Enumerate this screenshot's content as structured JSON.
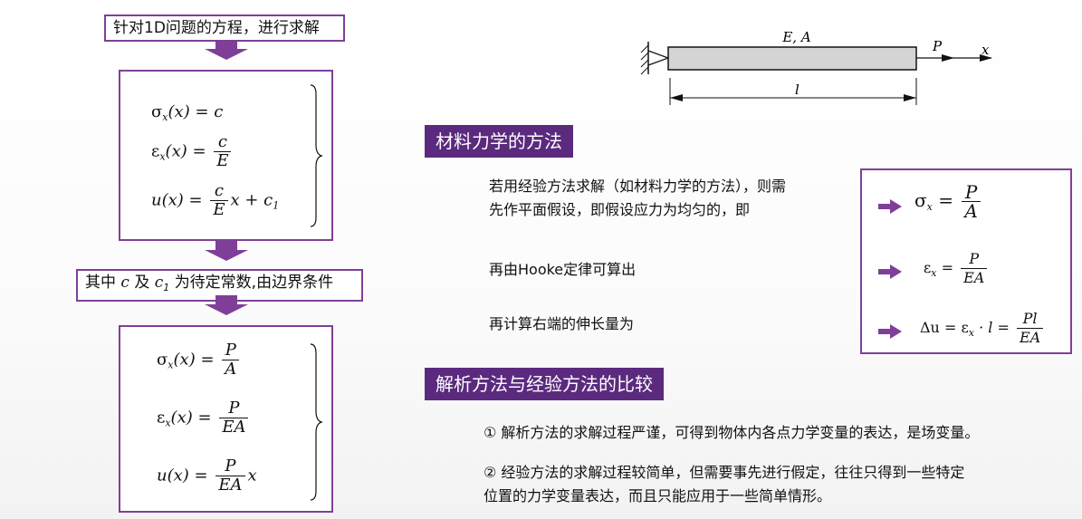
{
  "left": {
    "top_label": "针对1D问题的方程，进行求解",
    "eq1": {
      "lhs": "σ",
      "sub": "x",
      "arg": "(x)",
      "eq": "=",
      "rhs": "c"
    },
    "eq2": {
      "lhs": "ε",
      "sub": "x",
      "arg": "(x)",
      "eq": "=",
      "num": "c",
      "den": "E"
    },
    "eq3": {
      "lhs": "u(x)",
      "eq": "=",
      "num": "c",
      "den": "E",
      "tail": "x + c",
      "tail_sub": "1"
    },
    "mid_label_a": "其中",
    "mid_label_c": "c",
    "mid_label_and": "及",
    "mid_label_c1": "c",
    "mid_label_c1_sub": "1",
    "mid_label_b": "为待定常数,由边界条件",
    "eq4": {
      "lhs": "σ",
      "sub": "x",
      "arg": "(x)",
      "eq": "=",
      "num": "P",
      "den": "A"
    },
    "eq5": {
      "lhs": "ε",
      "sub": "x",
      "arg": "(x)",
      "eq": "=",
      "num": "P",
      "den": "EA"
    },
    "eq6": {
      "lhs": "u(x)",
      "eq": "=",
      "num": "P",
      "den": "EA",
      "tail": "x"
    }
  },
  "diagram": {
    "top_label": "E, A",
    "force_label": "P",
    "axis_label": "x",
    "length_label": "l"
  },
  "section1": {
    "title": "材料力学的方法",
    "para1_line1": "若用经验方法求解（如材料力学的方法），则需",
    "para1_line2": "先作平面假设，即假设应力为均匀的，即",
    "para2": "再由Hooke定律可算出",
    "para3": "再计算右端的伸长量为"
  },
  "right_box": {
    "eqA": {
      "lhs": "σ",
      "sub": "x",
      "eq": "=",
      "num": "P",
      "den": "A"
    },
    "eqB": {
      "lhs": "ε",
      "sub": "x",
      "eq": "=",
      "num": "P",
      "den": "EA"
    },
    "eqC": {
      "lhs": "Δu",
      "eq1": "=",
      "mid": "ε",
      "mid_sub": "x",
      "dot": "· l",
      "eq2": "=",
      "num": "Pl",
      "den": "EA"
    }
  },
  "section2": {
    "title": "解析方法与经验方法的比较",
    "item1": "①  解析方法的求解过程严谨，可得到物体内各点力学变量的表达，是场变量。",
    "item2_line1": "②  经验方法的求解过程较简单，但需要事先进行假定，往往只得到一些特定",
    "item2_line2": "位置的力学变量表达，而且只能应用于一些简单情形。"
  },
  "colors": {
    "accent": "#7f3f98",
    "title_bg": "#5b2a7e"
  }
}
